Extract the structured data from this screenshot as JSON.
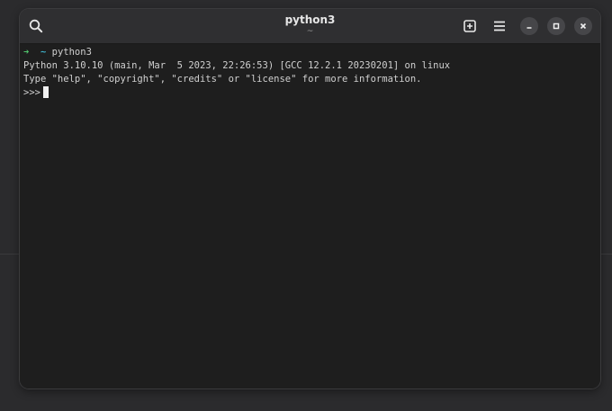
{
  "window": {
    "title": "python3",
    "subtitle": "~"
  },
  "toolbar": {
    "search_icon": "search-icon",
    "new_tab_icon": "new-tab-icon",
    "menu_icon": "hamburger-menu-icon",
    "minimize_icon": "minimize-icon",
    "maximize_icon": "maximize-icon",
    "close_icon": "close-icon"
  },
  "terminal": {
    "prompt_arrow": "➜",
    "prompt_dir": "~",
    "command": "python3",
    "lines": [
      "Python 3.10.10 (main, Mar  5 2023, 22:26:53) [GCC 12.2.1 20230201] on linux",
      "Type \"help\", \"copyright\", \"credits\" or \"license\" for more information."
    ],
    "repl_prompt": ">>>"
  },
  "colors": {
    "arrow": "#4fc16a",
    "tilde": "#3fb0c8",
    "terminal_bg": "#1e1e1e",
    "headerbar_bg": "#2f2f31",
    "text": "#d0d0d0"
  }
}
